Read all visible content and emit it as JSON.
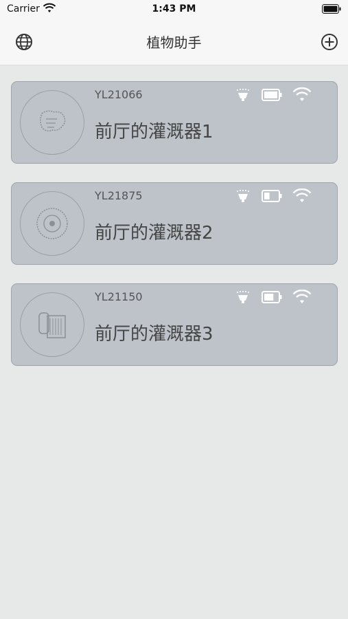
{
  "status": {
    "carrier": "Carrier",
    "time": "1:43 PM"
  },
  "nav": {
    "title": "植物助手",
    "left_icon": "globe-icon",
    "right_icon": "add-circle-icon"
  },
  "devices": [
    {
      "serial": "YL21066",
      "name": "前厅的灌溉器1",
      "battery_level": 1.0
    },
    {
      "serial": "YL21875",
      "name": "前厅的灌溉器2",
      "battery_level": 0.4
    },
    {
      "serial": "YL21150",
      "name": "前厅的灌溉器3",
      "battery_level": 0.7
    }
  ],
  "colors": {
    "card_bg": "#bdc3c9",
    "page_bg": "#e7e9e8",
    "nav_bg": "#f7f7f7"
  }
}
